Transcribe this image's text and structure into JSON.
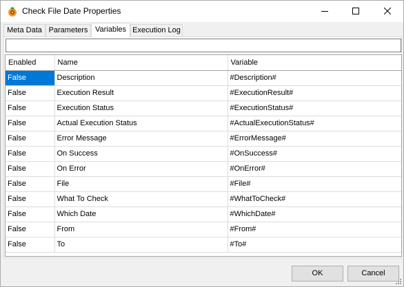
{
  "window": {
    "title": "Check File Date Properties",
    "controls": {
      "minimize_icon": "minimize-icon",
      "maximize_icon": "maximize-icon",
      "close_icon": "close-icon"
    }
  },
  "tabs": [
    {
      "label": "Meta Data",
      "active": false
    },
    {
      "label": "Parameters",
      "active": false
    },
    {
      "label": "Variables",
      "active": true
    },
    {
      "label": "Execution Log",
      "active": false
    }
  ],
  "filter": {
    "value": "",
    "placeholder": ""
  },
  "table": {
    "columns": [
      "Enabled",
      "Name",
      "Variable"
    ],
    "rows": [
      {
        "enabled": "False",
        "name": "Description",
        "variable": "#Description#",
        "selected": true
      },
      {
        "enabled": "False",
        "name": "Execution Result",
        "variable": "#ExecutionResult#"
      },
      {
        "enabled": "False",
        "name": "Execution Status",
        "variable": "#ExecutionStatus#"
      },
      {
        "enabled": "False",
        "name": "Actual Execution Status",
        "variable": "#ActualExecutionStatus#"
      },
      {
        "enabled": "False",
        "name": "Error Message",
        "variable": "#ErrorMessage#"
      },
      {
        "enabled": "False",
        "name": "On Success",
        "variable": "#OnSuccess#"
      },
      {
        "enabled": "False",
        "name": "On Error",
        "variable": "#OnError#"
      },
      {
        "enabled": "False",
        "name": "File",
        "variable": "#File#"
      },
      {
        "enabled": "False",
        "name": "What To Check",
        "variable": "#WhatToCheck#"
      },
      {
        "enabled": "False",
        "name": "Which Date",
        "variable": "#WhichDate#"
      },
      {
        "enabled": "False",
        "name": "From",
        "variable": "#From#"
      },
      {
        "enabled": "False",
        "name": "To",
        "variable": "#To#"
      }
    ]
  },
  "buttons": {
    "ok": "OK",
    "cancel": "Cancel"
  },
  "colors": {
    "selection": "#0078d7",
    "button_face": "#e1e1e1",
    "window_bg": "#f0f0f0"
  }
}
